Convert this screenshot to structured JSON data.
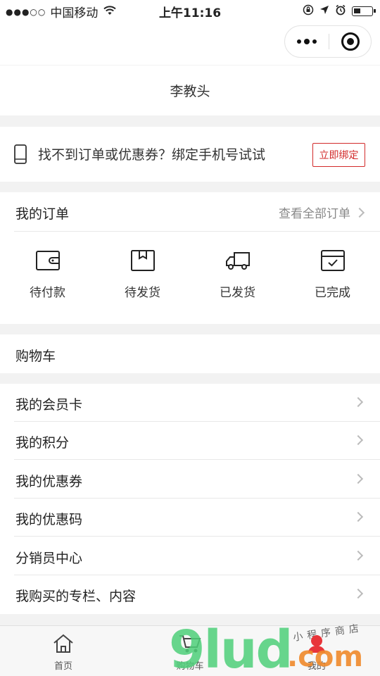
{
  "status_bar": {
    "carrier": "中国移动",
    "time": "上午11:16"
  },
  "user": {
    "name": "李教头"
  },
  "bind": {
    "text": "找不到订单或优惠券？绑定手机号试试",
    "button": "立即绑定",
    "accent": "#d22a2a"
  },
  "orders": {
    "title": "我的订单",
    "view_all": "查看全部订单",
    "items": [
      {
        "label": "待付款",
        "icon": "wallet-icon"
      },
      {
        "label": "待发货",
        "icon": "box-icon"
      },
      {
        "label": "已发货",
        "icon": "truck-icon"
      },
      {
        "label": "已完成",
        "icon": "check-box-icon"
      }
    ]
  },
  "cart": {
    "label": "购物车"
  },
  "menu": {
    "items": [
      {
        "label": "我的会员卡"
      },
      {
        "label": "我的积分"
      },
      {
        "label": "我的优惠券"
      },
      {
        "label": "我的优惠码"
      },
      {
        "label": "分销员中心"
      },
      {
        "label": "我购买的专栏、内容"
      }
    ]
  },
  "tabbar": {
    "items": [
      {
        "label": "首页",
        "icon": "home-icon"
      },
      {
        "label": "购物车",
        "icon": "cart-icon"
      },
      {
        "label": "我的",
        "icon": "user-icon"
      }
    ]
  },
  "watermark": {
    "brand": "9lud",
    "domain": ".com",
    "tagline": "小程序商店"
  }
}
